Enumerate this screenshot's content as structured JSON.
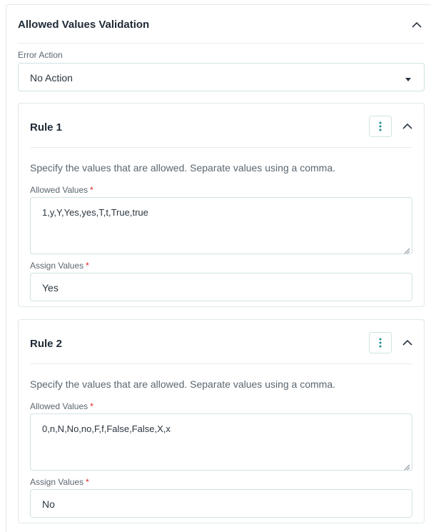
{
  "panel": {
    "title": "Allowed Values Validation",
    "collapse_icon": "chevron-up-icon"
  },
  "error_action": {
    "label": "Error Action",
    "selected": "No Action",
    "caret_icon": "caret-down-icon"
  },
  "rules": [
    {
      "title": "Rule 1",
      "menu_icon": "kebab-icon",
      "collapse_icon": "chevron-up-icon",
      "description": "Specify the values that are allowed. Separate values using a comma.",
      "allowed_values_label": "Allowed Values",
      "allowed_values": "1,y,Y,Yes,yes,T,t,True,true",
      "assign_values_label": "Assign Values",
      "assign_values": "Yes",
      "required_mark": "*"
    },
    {
      "title": "Rule 2",
      "menu_icon": "kebab-icon",
      "collapse_icon": "chevron-up-icon",
      "description": "Specify the values that are allowed. Separate values using a comma.",
      "allowed_values_label": "Allowed Values",
      "allowed_values": "0,n,N,No,no,F,f,False,False,X,x",
      "assign_values_label": "Assign Values",
      "assign_values": "No",
      "required_mark": "*"
    }
  ],
  "colors": {
    "border": "#cfe3e3",
    "accent_teal": "#1a8a8a",
    "required": "#e02020"
  }
}
